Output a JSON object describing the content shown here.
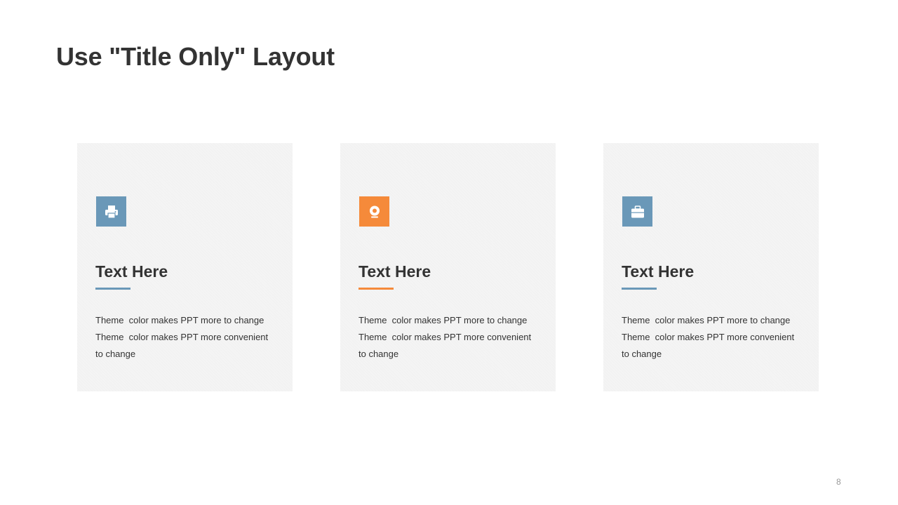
{
  "slide": {
    "title": "Use \"Title Only\" Layout",
    "page_number": "8"
  },
  "colors": {
    "blue_accent": "#6a98b8",
    "orange_accent": "#f58a3a",
    "card_background": "#f4f4f4",
    "text": "#333333"
  },
  "cards": [
    {
      "icon": "printer-icon",
      "accent": "#6a98b8",
      "heading": "Text Here",
      "body_lines": [
        "Theme  color makes PPT more to change",
        "Theme  color makes PPT more convenient",
        "to change"
      ]
    },
    {
      "icon": "location-pin-icon",
      "accent": "#f58a3a",
      "heading": "Text Here",
      "body_lines": [
        "Theme  color makes PPT more to change",
        "Theme  color makes PPT more convenient",
        "to change"
      ]
    },
    {
      "icon": "briefcase-icon",
      "accent": "#6a98b8",
      "heading": "Text Here",
      "body_lines": [
        "Theme  color makes PPT more to change",
        "Theme  color makes PPT more convenient",
        "to change"
      ]
    }
  ]
}
